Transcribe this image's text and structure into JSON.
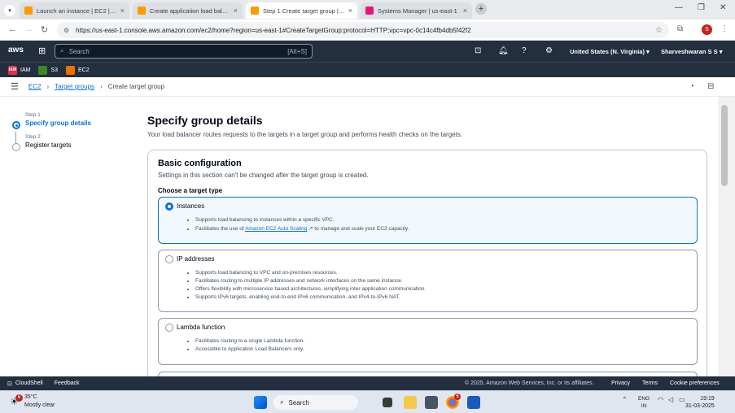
{
  "browser": {
    "tabs": [
      {
        "title": "Launch an instance | EC2 | us-e...",
        "active": false,
        "color": "#ff9900"
      },
      {
        "title": "Create application load balanc...",
        "active": false,
        "color": "#ff9900"
      },
      {
        "title": "Step 1 Create target group | EC...",
        "active": true,
        "color": "#ff9900"
      },
      {
        "title": "Systems Manager | us-east-1",
        "active": false,
        "color": "#e7157b"
      }
    ],
    "url": "https://us-east-1.console.aws.amazon.com/ec2/home?region=us-east-1#CreateTargetGroup:protocol=HTTP;vpc=vpc-0c14c4fb4db5f42f2",
    "profile_initial": "S"
  },
  "aws_nav": {
    "logo": "aws",
    "search_placeholder": "Search",
    "search_shortcut": "[Alt+S]",
    "region": "United States (N. Virginia)",
    "user": "Sharveshwaran S S"
  },
  "favorites": [
    {
      "label": "IAM",
      "color": "#dd344c",
      "abbr": "IAM"
    },
    {
      "label": "S3",
      "color": "#3f8624",
      "abbr": "S3"
    },
    {
      "label": "EC2",
      "color": "#ed7100",
      "abbr": "EC2"
    }
  ],
  "breadcrumb": {
    "root": "EC2",
    "parent": "Target groups",
    "current": "Create target group"
  },
  "wizard": {
    "steps": [
      {
        "label": "Step 1",
        "name": "Specify group details",
        "active": true
      },
      {
        "label": "Step 2",
        "name": "Register targets",
        "active": false
      }
    ]
  },
  "page": {
    "title": "Specify group details",
    "subtitle": "Your load balancer routes requests to the targets in a target group and performs health checks on the targets."
  },
  "basic_config": {
    "heading": "Basic configuration",
    "description": "Settings in this section can't be changed after the target group is created.",
    "target_type_label": "Choose a target type",
    "options": [
      {
        "label": "Instances",
        "selected": true,
        "bullets": [
          "Supports load balancing to instances within a specific VPC.",
          "Facilitates the use of"
        ],
        "link_text": "Amazon EC2 Auto Scaling",
        "link_suffix": "to manage and scale your EC2 capacity."
      },
      {
        "label": "IP addresses",
        "selected": false,
        "bullets": [
          "Supports load balancing to VPC and on-premises resources.",
          "Facilitates routing to multiple IP addresses and network interfaces on the same instance.",
          "Offers flexibility with microservice based architectures, simplifying inter-application communication.",
          "Supports IPv6 targets, enabling end-to-end IPv6 communication, and IPv4-to-IPv6 NAT."
        ]
      },
      {
        "label": "Lambda function",
        "selected": false,
        "bullets": [
          "Facilitates routing to a single Lambda function.",
          "Accessible to Application Load Balancers only."
        ]
      }
    ]
  },
  "footer": {
    "cloudshell": "CloudShell",
    "feedback": "Feedback",
    "copyright": "© 2025, Amazon Web Services, Inc. or its affiliates.",
    "links": [
      "Privacy",
      "Terms",
      "Cookie preferences"
    ]
  },
  "taskbar": {
    "weather_temp": "35°C",
    "weather_desc": "Mostly clear",
    "weather_badge": "6",
    "search": "Search",
    "chrome_badge": "6",
    "lang_top": "ENG",
    "lang_bottom": "IN",
    "time": "19:19",
    "date": "31-03-2025"
  }
}
